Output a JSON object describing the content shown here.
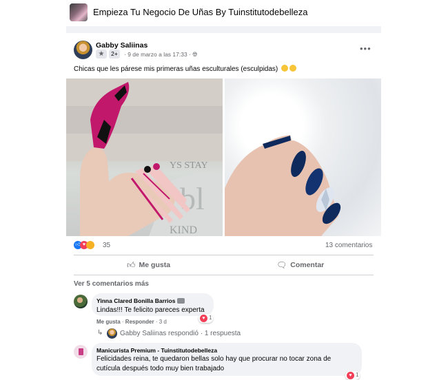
{
  "group": {
    "title": "Empieza Tu Negocio De Uñas By Tuinstitutodebelleza"
  },
  "post": {
    "author": "Gabby Saliinas",
    "badge_count": "2+",
    "date": "9 de marzo a las 17:33",
    "separator": "·",
    "more_icon": "•••",
    "text": "Chicas que les párese mis primeras uñas esculturales (esculpidas)",
    "icons": [
      "ellipsis-icon",
      "globe-icon",
      "star-badge-icon"
    ]
  },
  "stats": {
    "reaction_count": "35",
    "comment_count": "13 comentarios"
  },
  "actions": {
    "like_label": "Me gusta",
    "comment_label": "Comentar"
  },
  "comments": {
    "view_more": "Ver 5 comentarios más",
    "c1": {
      "author": "Yinna Clared Bonilla Barrios",
      "text": "Lindas!!! Te felicito pareces experta",
      "like_action": "Me gusta",
      "reply_action": "Responder",
      "time": "3 d",
      "reaction_count": "1",
      "reply_summary": "Gabby Saliinas respondió · 1 respuesta"
    },
    "c2": {
      "author": "Manicurista Premium - Tuinstitutodebelleza",
      "line1": "Felicidades reina, te quedaron bellas solo hay que procurar no tocar zona de",
      "line2": "cutícula después todo muy bien trabajado",
      "reaction_count": "1"
    }
  },
  "colors": {
    "accent": "#1877f2",
    "love": "#f33e58",
    "muted": "#65676b",
    "bubble": "#f0f2f5"
  }
}
